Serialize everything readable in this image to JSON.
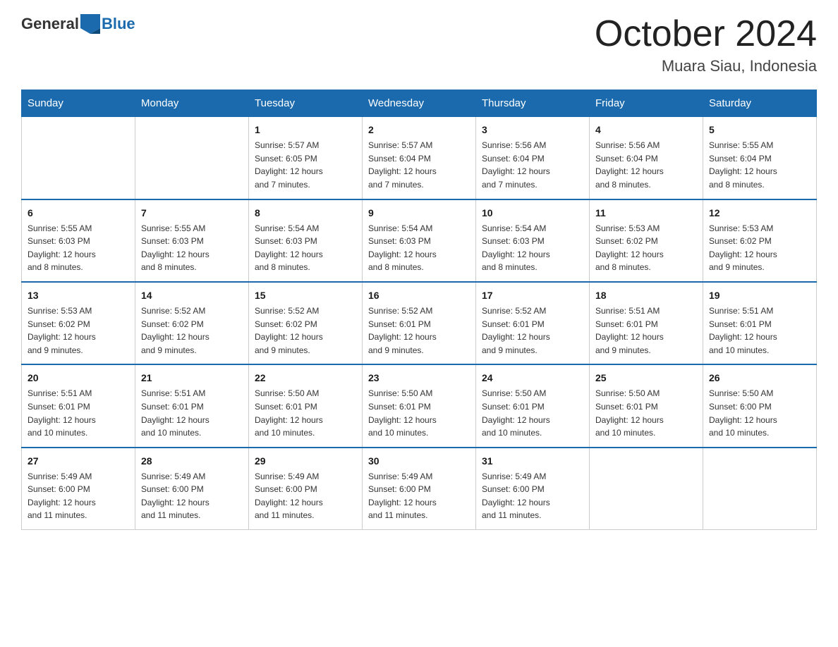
{
  "logo": {
    "text_general": "General",
    "text_blue": "Blue"
  },
  "title": "October 2024",
  "subtitle": "Muara Siau, Indonesia",
  "headers": [
    "Sunday",
    "Monday",
    "Tuesday",
    "Wednesday",
    "Thursday",
    "Friday",
    "Saturday"
  ],
  "weeks": [
    [
      {
        "day": "",
        "info": ""
      },
      {
        "day": "",
        "info": ""
      },
      {
        "day": "1",
        "info": "Sunrise: 5:57 AM\nSunset: 6:05 PM\nDaylight: 12 hours\nand 7 minutes."
      },
      {
        "day": "2",
        "info": "Sunrise: 5:57 AM\nSunset: 6:04 PM\nDaylight: 12 hours\nand 7 minutes."
      },
      {
        "day": "3",
        "info": "Sunrise: 5:56 AM\nSunset: 6:04 PM\nDaylight: 12 hours\nand 7 minutes."
      },
      {
        "day": "4",
        "info": "Sunrise: 5:56 AM\nSunset: 6:04 PM\nDaylight: 12 hours\nand 8 minutes."
      },
      {
        "day": "5",
        "info": "Sunrise: 5:55 AM\nSunset: 6:04 PM\nDaylight: 12 hours\nand 8 minutes."
      }
    ],
    [
      {
        "day": "6",
        "info": "Sunrise: 5:55 AM\nSunset: 6:03 PM\nDaylight: 12 hours\nand 8 minutes."
      },
      {
        "day": "7",
        "info": "Sunrise: 5:55 AM\nSunset: 6:03 PM\nDaylight: 12 hours\nand 8 minutes."
      },
      {
        "day": "8",
        "info": "Sunrise: 5:54 AM\nSunset: 6:03 PM\nDaylight: 12 hours\nand 8 minutes."
      },
      {
        "day": "9",
        "info": "Sunrise: 5:54 AM\nSunset: 6:03 PM\nDaylight: 12 hours\nand 8 minutes."
      },
      {
        "day": "10",
        "info": "Sunrise: 5:54 AM\nSunset: 6:03 PM\nDaylight: 12 hours\nand 8 minutes."
      },
      {
        "day": "11",
        "info": "Sunrise: 5:53 AM\nSunset: 6:02 PM\nDaylight: 12 hours\nand 8 minutes."
      },
      {
        "day": "12",
        "info": "Sunrise: 5:53 AM\nSunset: 6:02 PM\nDaylight: 12 hours\nand 9 minutes."
      }
    ],
    [
      {
        "day": "13",
        "info": "Sunrise: 5:53 AM\nSunset: 6:02 PM\nDaylight: 12 hours\nand 9 minutes."
      },
      {
        "day": "14",
        "info": "Sunrise: 5:52 AM\nSunset: 6:02 PM\nDaylight: 12 hours\nand 9 minutes."
      },
      {
        "day": "15",
        "info": "Sunrise: 5:52 AM\nSunset: 6:02 PM\nDaylight: 12 hours\nand 9 minutes."
      },
      {
        "day": "16",
        "info": "Sunrise: 5:52 AM\nSunset: 6:01 PM\nDaylight: 12 hours\nand 9 minutes."
      },
      {
        "day": "17",
        "info": "Sunrise: 5:52 AM\nSunset: 6:01 PM\nDaylight: 12 hours\nand 9 minutes."
      },
      {
        "day": "18",
        "info": "Sunrise: 5:51 AM\nSunset: 6:01 PM\nDaylight: 12 hours\nand 9 minutes."
      },
      {
        "day": "19",
        "info": "Sunrise: 5:51 AM\nSunset: 6:01 PM\nDaylight: 12 hours\nand 10 minutes."
      }
    ],
    [
      {
        "day": "20",
        "info": "Sunrise: 5:51 AM\nSunset: 6:01 PM\nDaylight: 12 hours\nand 10 minutes."
      },
      {
        "day": "21",
        "info": "Sunrise: 5:51 AM\nSunset: 6:01 PM\nDaylight: 12 hours\nand 10 minutes."
      },
      {
        "day": "22",
        "info": "Sunrise: 5:50 AM\nSunset: 6:01 PM\nDaylight: 12 hours\nand 10 minutes."
      },
      {
        "day": "23",
        "info": "Sunrise: 5:50 AM\nSunset: 6:01 PM\nDaylight: 12 hours\nand 10 minutes."
      },
      {
        "day": "24",
        "info": "Sunrise: 5:50 AM\nSunset: 6:01 PM\nDaylight: 12 hours\nand 10 minutes."
      },
      {
        "day": "25",
        "info": "Sunrise: 5:50 AM\nSunset: 6:01 PM\nDaylight: 12 hours\nand 10 minutes."
      },
      {
        "day": "26",
        "info": "Sunrise: 5:50 AM\nSunset: 6:00 PM\nDaylight: 12 hours\nand 10 minutes."
      }
    ],
    [
      {
        "day": "27",
        "info": "Sunrise: 5:49 AM\nSunset: 6:00 PM\nDaylight: 12 hours\nand 11 minutes."
      },
      {
        "day": "28",
        "info": "Sunrise: 5:49 AM\nSunset: 6:00 PM\nDaylight: 12 hours\nand 11 minutes."
      },
      {
        "day": "29",
        "info": "Sunrise: 5:49 AM\nSunset: 6:00 PM\nDaylight: 12 hours\nand 11 minutes."
      },
      {
        "day": "30",
        "info": "Sunrise: 5:49 AM\nSunset: 6:00 PM\nDaylight: 12 hours\nand 11 minutes."
      },
      {
        "day": "31",
        "info": "Sunrise: 5:49 AM\nSunset: 6:00 PM\nDaylight: 12 hours\nand 11 minutes."
      },
      {
        "day": "",
        "info": ""
      },
      {
        "day": "",
        "info": ""
      }
    ]
  ]
}
